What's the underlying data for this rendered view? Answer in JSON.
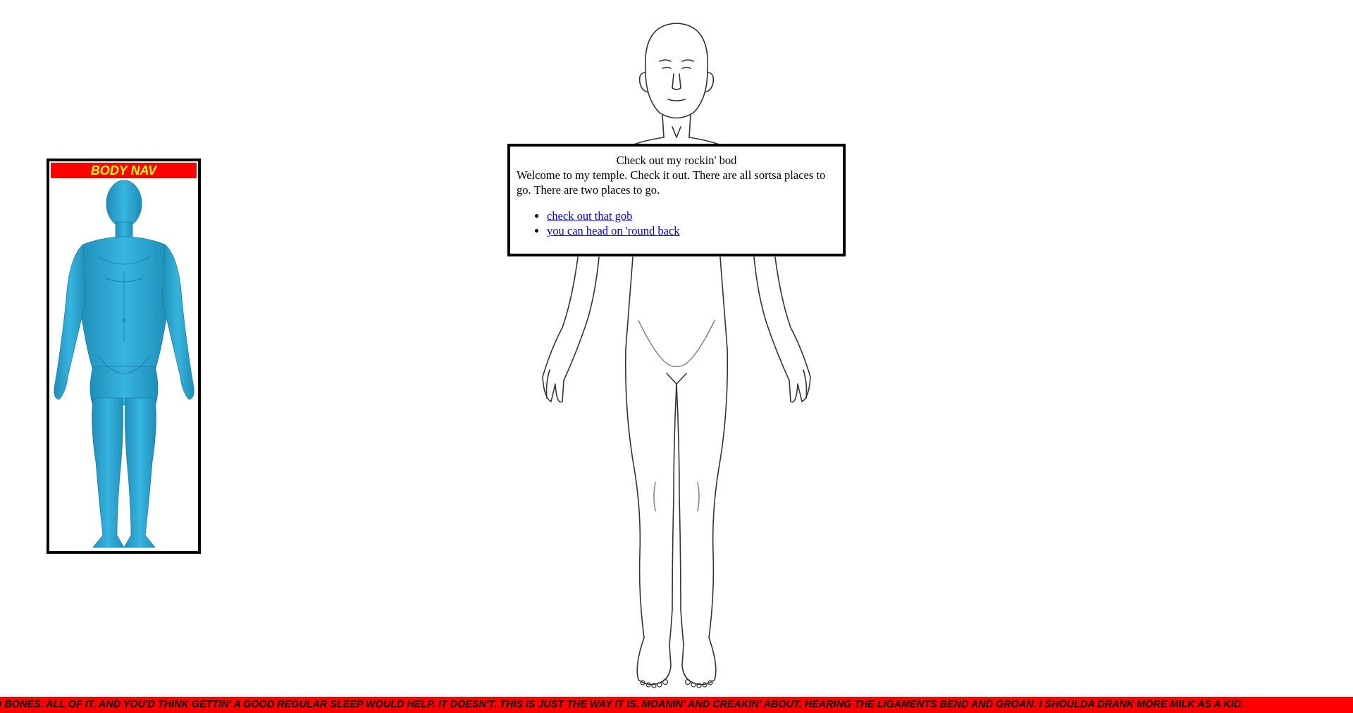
{
  "nav": {
    "title": "BODY NAV",
    "figure_color": "#29a9d6",
    "icon": "human-figure-icon"
  },
  "main_figure": {
    "icon": "body-outline-icon"
  },
  "dialog": {
    "title": "Check out my rockin' bod",
    "body": "Welcome to my temple. Check it out. There are all sortsa places to go. There are two places to go.",
    "links": [
      {
        "label": "check out that gob"
      },
      {
        "label": "you can head on 'round back"
      }
    ]
  },
  "ticker": {
    "text": "D BONES. ALL OF IT. AND YOU'D THINK GETTIN' A GOOD REGULAR SLEEP WOULD HELP. IT DOESN'T. THIS IS JUST THE WAY IT IS. MOANIN' AND CREAKIN' ABOUT. HEARING THE LIGAMENTS BEND AND GROAN. I SHOULDA DRANK MORE MILK AS A KID.",
    "bg": "#ff0000"
  }
}
